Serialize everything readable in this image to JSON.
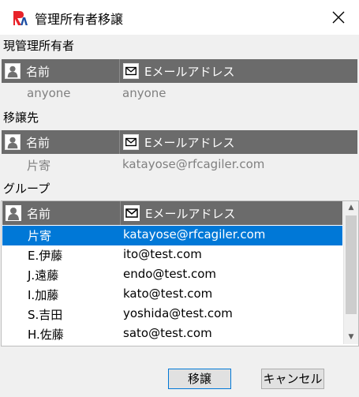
{
  "window": {
    "title": "管理所有者移譲"
  },
  "current_owner": {
    "label": "現管理所有者",
    "columns": [
      "名前",
      "Eメールアドレス"
    ],
    "row": {
      "name": "anyone",
      "email": "anyone"
    }
  },
  "transfer_to": {
    "label": "移譲先",
    "columns": [
      "名前",
      "Eメールアドレス"
    ],
    "row": {
      "name": "片寄",
      "email": "katayose@rfcagiler.com"
    }
  },
  "group": {
    "label": "グループ",
    "columns": [
      "名前",
      "Eメールアドレス"
    ],
    "rows": [
      {
        "name": "片寄",
        "email": "katayose@rfcagiler.com",
        "selected": true
      },
      {
        "name": "E.伊藤",
        "email": "ito@test.com"
      },
      {
        "name": "J.遠藤",
        "email": "endo@test.com"
      },
      {
        "name": "I.加藤",
        "email": "kato@test.com"
      },
      {
        "name": "S.吉田",
        "email": "yoshida@test.com"
      },
      {
        "name": "H.佐藤",
        "email": "sato@test.com"
      }
    ]
  },
  "buttons": {
    "transfer": "移譲",
    "cancel": "キャンセル"
  },
  "colors": {
    "header_bg": "#6b6b6b",
    "selection": "#0078d7",
    "logo_red": "#e8232a",
    "logo_blue": "#1e4fa3"
  },
  "icons": {
    "person": "person-icon",
    "mail": "mail-icon",
    "close": "close-icon"
  }
}
